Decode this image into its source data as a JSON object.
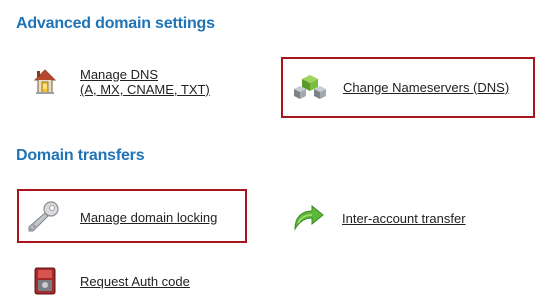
{
  "advanced_settings": {
    "heading": "Advanced domain settings",
    "manage_dns": {
      "line1": "Manage DNS",
      "line2": "(A, MX, CNAME, TXT)",
      "icon": "house-icon"
    },
    "change_nameservers": {
      "label": "Change Nameservers (DNS)",
      "icon": "network-cubes-icon",
      "highlighted": true
    }
  },
  "domain_transfers": {
    "heading": "Domain transfers",
    "manage_locking": {
      "label": "Manage domain locking",
      "icon": "key-icon",
      "highlighted": true
    },
    "inter_account": {
      "label": "Inter-account transfer",
      "icon": "green-arrow-icon"
    },
    "request_auth": {
      "label": "Request Auth code",
      "icon": "red-device-icon"
    }
  },
  "colors": {
    "heading": "#1f73b7",
    "highlight_border": "#a8151e",
    "link_text": "#222222"
  }
}
